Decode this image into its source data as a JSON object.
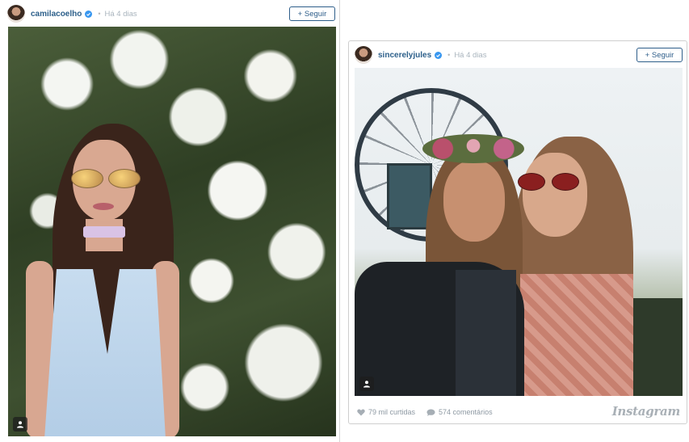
{
  "posts": [
    {
      "username": "camilacoelho",
      "time": "Há 4 dias",
      "follow_label": "+ Seguir"
    },
    {
      "username": "sincerelyjules",
      "time": "Há 4 dias",
      "follow_label": "+ Seguir",
      "likes": "79 mil curtidas",
      "comments": "574 comentários",
      "logo": "Instagram"
    }
  ],
  "separator": "•",
  "colors": {
    "accent": "#2e5e8a",
    "verified": "#3897f0",
    "muted": "#a9b4bd"
  }
}
